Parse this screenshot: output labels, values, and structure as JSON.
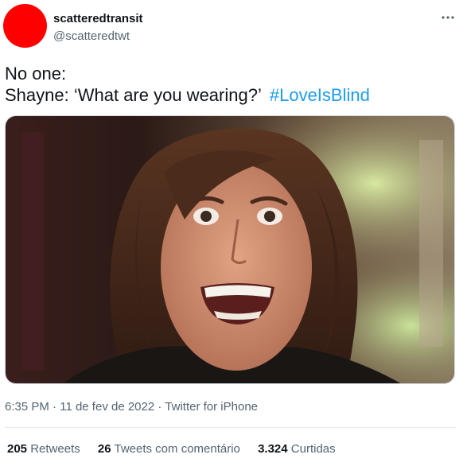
{
  "author": {
    "display_name": "scatteredtransit",
    "handle": "@scatteredtwt",
    "avatar_color": "#ff0000"
  },
  "menu_icon": "more-horizontal-icon",
  "tweet": {
    "line1": "No one:",
    "line2": "Shayne: ‘What are you wearing?’",
    "hashtag": "#LoveIsBlind",
    "hashtag_color": "#1d9bf0"
  },
  "media": {
    "kind": "photo of a grinning long-haired man against a blurred background"
  },
  "meta": {
    "time": "6:35 PM",
    "date": "11 de fev de 2022",
    "source": "Twitter for iPhone"
  },
  "stats": {
    "retweets_count": "205",
    "retweets_label": "Retweets",
    "quotes_count": "26",
    "quotes_label": "Tweets com comentário",
    "likes_count": "3.324",
    "likes_label": "Curtidas"
  }
}
